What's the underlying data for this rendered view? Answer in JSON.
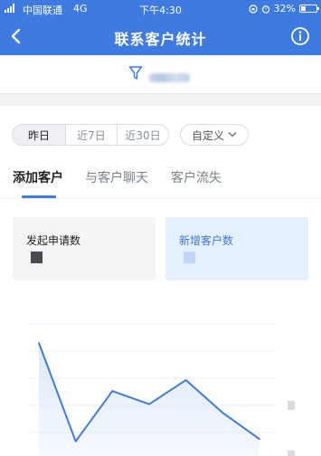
{
  "status_bar": {
    "carrier": "中国联通",
    "network": "4G",
    "time": "下午4:30",
    "battery": "32%",
    "battery_level": 0.32
  },
  "header": {
    "title": "联系客户统计",
    "back_icon": "chevron-left-icon",
    "info_icon": "info-circle-icon"
  },
  "filter": {
    "icon": "filter-funnel-icon"
  },
  "date_range": {
    "options": [
      "昨日",
      "近7日",
      "近30日"
    ],
    "selected": "昨日",
    "custom_label": "自定义"
  },
  "tabs": {
    "items": [
      "添加客户",
      "与客户聊天",
      "客户流失"
    ],
    "active": "添加客户"
  },
  "cards": [
    {
      "label": "发起申请数",
      "active": false
    },
    {
      "label": "新增客户数",
      "active": true
    }
  ],
  "chart_data": {
    "type": "area",
    "title": "",
    "xlabel": "",
    "ylabel": "",
    "series": [
      {
        "values": [
          6,
          1.5,
          3.8,
          3.2,
          4.3,
          2.8,
          1.6
        ]
      }
    ],
    "gridlines": 6,
    "grid": true,
    "colors": {
      "line": "#3e7ae0",
      "fill": "#dbe8fb",
      "grid": "#eef0f2"
    }
  },
  "colors": {
    "accent": "#3e7ae0",
    "header_bg": "#3e7ae0",
    "band": "#f2f3f5"
  }
}
